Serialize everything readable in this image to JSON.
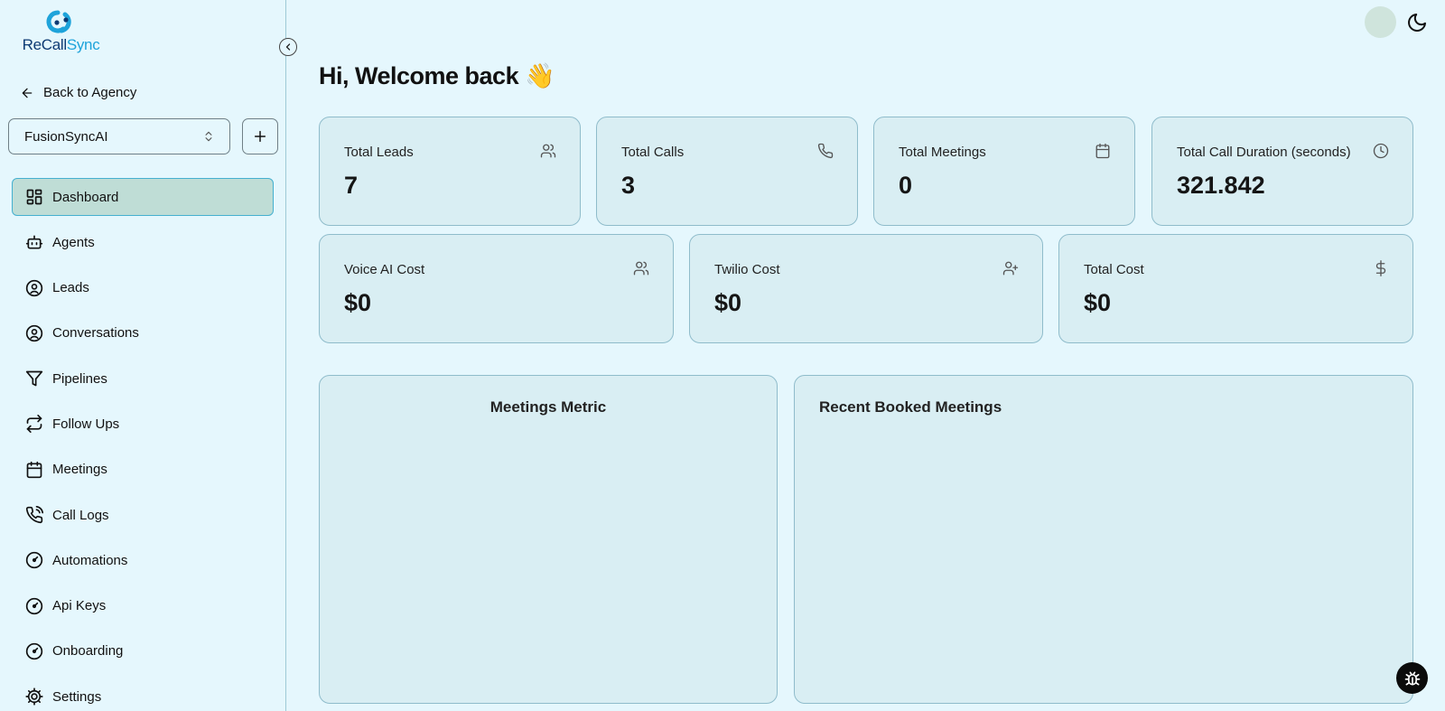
{
  "brand": {
    "name_part1": "ReCall",
    "name_part2": "Sync",
    "color_dark": "#0e3a73",
    "color_light": "#1ea3da"
  },
  "sidebar": {
    "back_label": "Back to Agency",
    "org_selected": "FusionSyncAI",
    "items": [
      {
        "label": "Dashboard",
        "icon": "dashboard-icon",
        "active": true
      },
      {
        "label": "Agents",
        "icon": "bot-icon"
      },
      {
        "label": "Leads",
        "icon": "user-circle-icon"
      },
      {
        "label": "Conversations",
        "icon": "user-circle-icon"
      },
      {
        "label": "Pipelines",
        "icon": "filter-icon"
      },
      {
        "label": "Follow Ups",
        "icon": "repeat-icon"
      },
      {
        "label": "Meetings",
        "icon": "calendar-icon"
      },
      {
        "label": "Call Logs",
        "icon": "phone-call-icon"
      },
      {
        "label": "Automations",
        "icon": "gauge-icon"
      },
      {
        "label": "Api Keys",
        "icon": "gauge-icon"
      },
      {
        "label": "Onboarding",
        "icon": "gauge-icon"
      },
      {
        "label": "Settings",
        "icon": "gear-icon"
      }
    ]
  },
  "main": {
    "greeting": "Hi, Welcome back 👋",
    "stats_row1": [
      {
        "label": "Total Leads",
        "value": "7",
        "icon": "users-icon"
      },
      {
        "label": "Total Calls",
        "value": "3",
        "icon": "phone-icon"
      },
      {
        "label": "Total Meetings",
        "value": "0",
        "icon": "calendar-icon"
      },
      {
        "label": "Total Call Duration (seconds)",
        "value": "321.842",
        "icon": "clock-icon"
      }
    ],
    "stats_row2": [
      {
        "label": "Voice AI Cost",
        "value": "$0",
        "icon": "users-icon"
      },
      {
        "label": "Twilio Cost",
        "value": "$0",
        "icon": "user-plus-icon"
      },
      {
        "label": "Total Cost",
        "value": "$0",
        "icon": "dollar-icon"
      }
    ],
    "meetings_metric_title": "Meetings Metric",
    "recent_meetings_title": "Recent Booked Meetings"
  },
  "colors": {
    "background": "#e5f7fd",
    "card": "#d9eef3",
    "card_border": "#8fbccb",
    "active_nav": "#bfddd6",
    "active_nav_border": "#45b0d0"
  }
}
